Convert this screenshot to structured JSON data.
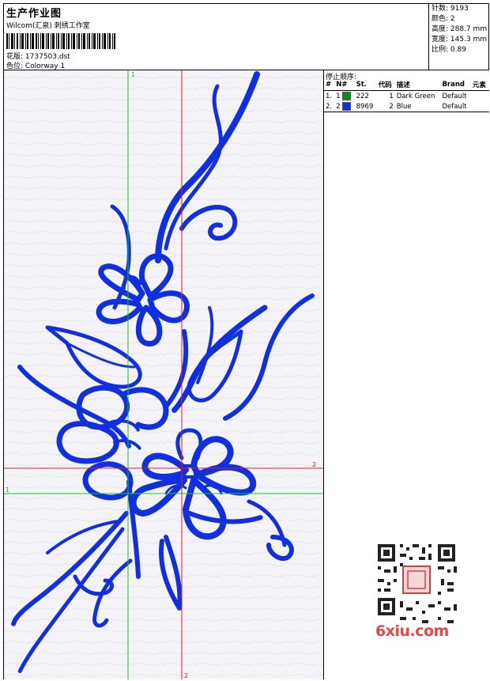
{
  "header": {
    "title": "生产作业图",
    "company": "Wilcom(汇泉) 刺绣工作室",
    "design_label": "花版:",
    "design_value": "1737503.dst",
    "colorway_label": "色位:",
    "colorway_value": "Colorway 1"
  },
  "stats": [
    {
      "label": "针数:",
      "value": "9193"
    },
    {
      "label": "颜色:",
      "value": "2"
    },
    {
      "label": "高度:",
      "value": "288.7 mm"
    },
    {
      "label": "宽度:",
      "value": "145.3 mm"
    },
    {
      "label": "比例:",
      "value": "0.89"
    }
  ],
  "stop_sequence": {
    "title": "停止顺序:",
    "columns": [
      "#",
      "N#",
      "St.",
      "代码",
      "描述",
      "Brand",
      "元素"
    ],
    "rows": [
      {
        "num": "1.",
        "n": "1",
        "color": "#108a10",
        "stitches": "222",
        "code": "1",
        "desc": "Dark Green",
        "brand": "Default",
        "element": ""
      },
      {
        "num": "2.",
        "n": "2",
        "color": "#1030e0",
        "stitches": "8969",
        "code": "2",
        "desc": "Blue",
        "brand": "Default",
        "element": ""
      }
    ]
  },
  "guides": {
    "top_label": "1",
    "left_label": "1",
    "right_label": "2",
    "bottom_label": "2",
    "green_color": "#20c020",
    "red_color": "#e02020"
  },
  "embroidery": {
    "stitch_color": "#1030e0"
  },
  "watermark": {
    "text": "6xiu.com"
  }
}
